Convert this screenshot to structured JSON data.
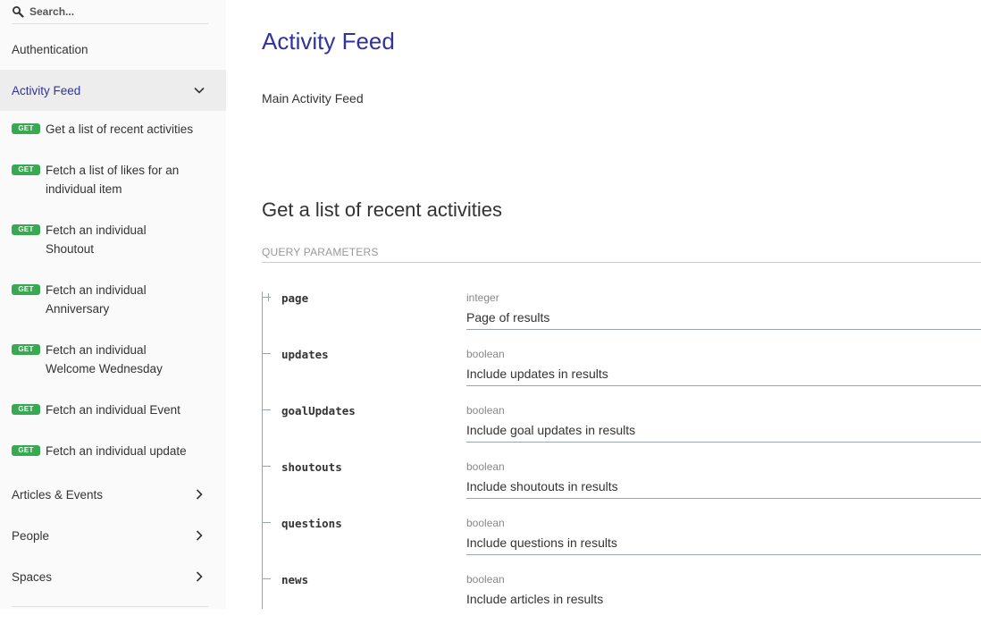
{
  "search": {
    "placeholder": "Search..."
  },
  "sidebar": {
    "groups_top": [
      {
        "label": "Authentication"
      },
      {
        "label": "Activity Feed"
      }
    ],
    "operations": [
      {
        "method": "GET",
        "label": "Get a list of recent activities"
      },
      {
        "method": "GET",
        "label": "Fetch a list of likes for an individual item"
      },
      {
        "method": "GET",
        "label": "Fetch an individual Shoutout"
      },
      {
        "method": "GET",
        "label": "Fetch an individual Anniversary"
      },
      {
        "method": "GET",
        "label": "Fetch an individual Welcome Wednesday"
      },
      {
        "method": "GET",
        "label": "Fetch an individual Event"
      },
      {
        "method": "GET",
        "label": "Fetch an individual update"
      }
    ],
    "groups_bottom": [
      {
        "label": "Articles & Events"
      },
      {
        "label": "People"
      },
      {
        "label": "Spaces"
      }
    ]
  },
  "main": {
    "title": "Activity Feed",
    "description": "Main Activity Feed",
    "section_title": "Get a list of recent activities",
    "query_header": "QUERY PARAMETERS",
    "params": [
      {
        "name": "page",
        "type": "integer",
        "desc": "Page of results"
      },
      {
        "name": "updates",
        "type": "boolean",
        "desc": "Include updates in results"
      },
      {
        "name": "goalUpdates",
        "type": "boolean",
        "desc": "Include goal updates in results"
      },
      {
        "name": "shoutouts",
        "type": "boolean",
        "desc": "Include shoutouts in results"
      },
      {
        "name": "questions",
        "type": "boolean",
        "desc": "Include questions in results"
      },
      {
        "name": "news",
        "type": "boolean",
        "desc": "Include articles in results"
      }
    ]
  },
  "colors": {
    "accent": "#32329f",
    "get_badge": "#3aa853"
  }
}
